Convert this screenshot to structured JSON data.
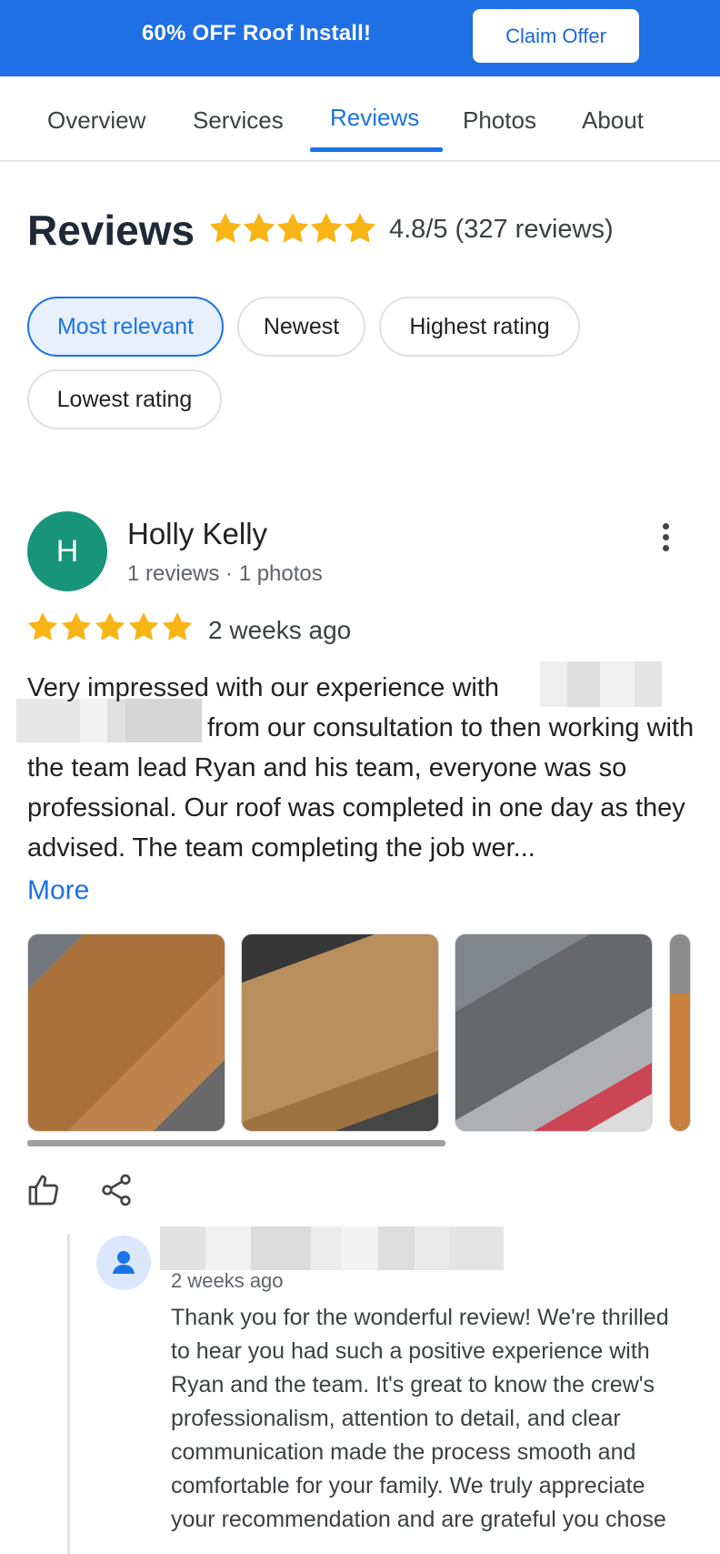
{
  "promo": {
    "text": "60% OFF Roof Install!",
    "button_label": "Claim Offer",
    "background_color": "#1f6fe5"
  },
  "tabs": [
    {
      "label": "Overview",
      "active": false
    },
    {
      "label": "Services",
      "active": false
    },
    {
      "label": "Reviews",
      "active": true
    },
    {
      "label": "Photos",
      "active": false
    },
    {
      "label": "About",
      "active": false
    }
  ],
  "reviews_header": {
    "title": "Reviews",
    "rating_summary": "4.8/5 (327 reviews)",
    "star_color": "#f9b415"
  },
  "sort_chips": [
    {
      "label": "Most relevant",
      "active": true
    },
    {
      "label": "Newest",
      "active": false
    },
    {
      "label": "Highest rating",
      "active": false
    },
    {
      "label": "Lowest rating",
      "active": false
    }
  ],
  "review": {
    "avatar_initial": "H",
    "avatar_color": "#17947a",
    "name": "Holly Kelly",
    "meta": "1 reviews · 1 photos",
    "stars": 5,
    "time": "2 weeks ago",
    "text_part1": "Very impressed with our experience with",
    "text_part2": "from our consultation to then working with the team lead Ryan and his team, everyone was so professional. Our roof was completed in one day as they advised. The team completing the job wer...",
    "more_label": "More",
    "photo_count_visible": 4,
    "icons": [
      "thumbs-up-icon",
      "share-icon",
      "more-vert-icon"
    ]
  },
  "owner_reply": {
    "time": "2 weeks ago",
    "text": "Thank you for the wonderful review! We're thrilled to hear you had such a positive experience with Ryan and the team. It's great to know the crew's professionalism, attention to detail, and clear communication made the process smooth and comfortable for your family. We truly appreciate your recommendation and are grateful you chose"
  }
}
